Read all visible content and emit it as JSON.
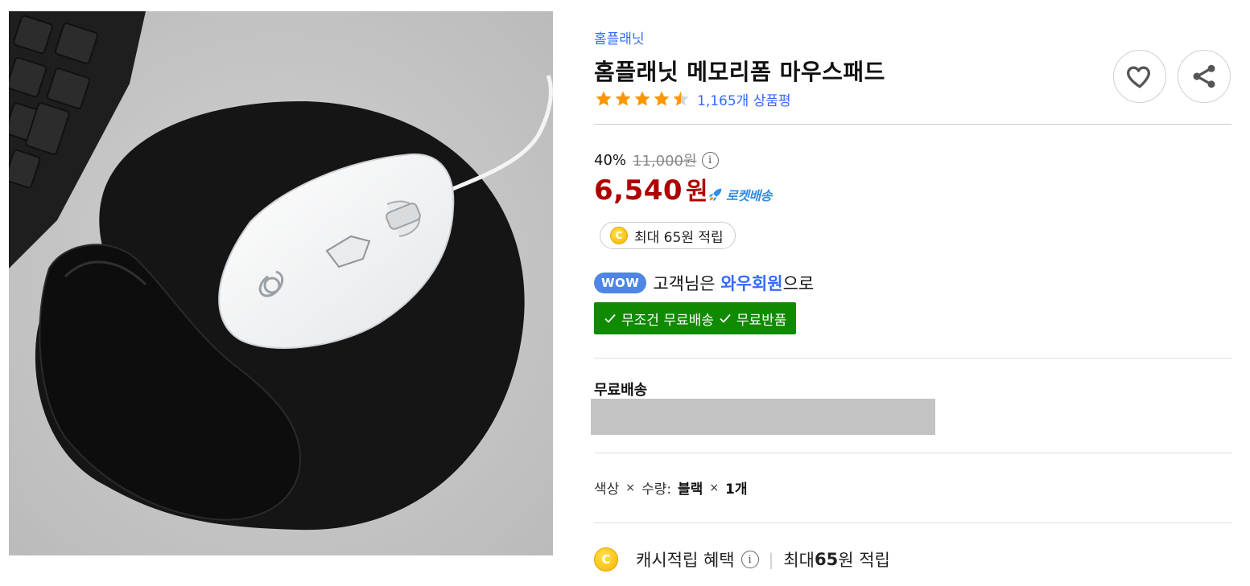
{
  "product": {
    "brand": "홈플래닛",
    "title": "홈플래닛 메모리폼 마우스패드",
    "rating": 4.5,
    "rating_max": 5,
    "review_count": "1,165개 상품평"
  },
  "price": {
    "discount_rate": "40%",
    "original": "11,000원",
    "sale_amount": "6,540",
    "sale_unit": "원",
    "delivery_badge": "로켓배송"
  },
  "points": {
    "chip_coin": "C",
    "chip_text": "최대 65원 적립"
  },
  "wow": {
    "badge": "WOW",
    "prefix": "고객님은 ",
    "highlight": "와우회원",
    "suffix": "으로",
    "benefit_1": "무조건 무료배송",
    "benefit_2": "무료반품"
  },
  "shipping": {
    "label": "무료배송"
  },
  "option": {
    "label_1": "색상",
    "times": "×",
    "label_2": "수량:",
    "value_1": "블랙",
    "value_2": "1개"
  },
  "cash": {
    "coin": "C",
    "label": "캐시적립 혜택",
    "separator": "|",
    "prefix": "최대 ",
    "amount": "65",
    "suffix": "원 적립"
  },
  "colors": {
    "brand_link": "#346aff",
    "sale_price": "#ae0000",
    "rocket": "#2f8ee8",
    "wow_badge": "#4f86e4",
    "benefit_bg": "#108a00",
    "star": "#ff9600"
  },
  "icons": {
    "wish": "heart-icon",
    "share": "share-icon",
    "info": "info-icon",
    "rocket": "rocket-icon",
    "check": "check-icon",
    "coin": "cash-coin-icon"
  }
}
